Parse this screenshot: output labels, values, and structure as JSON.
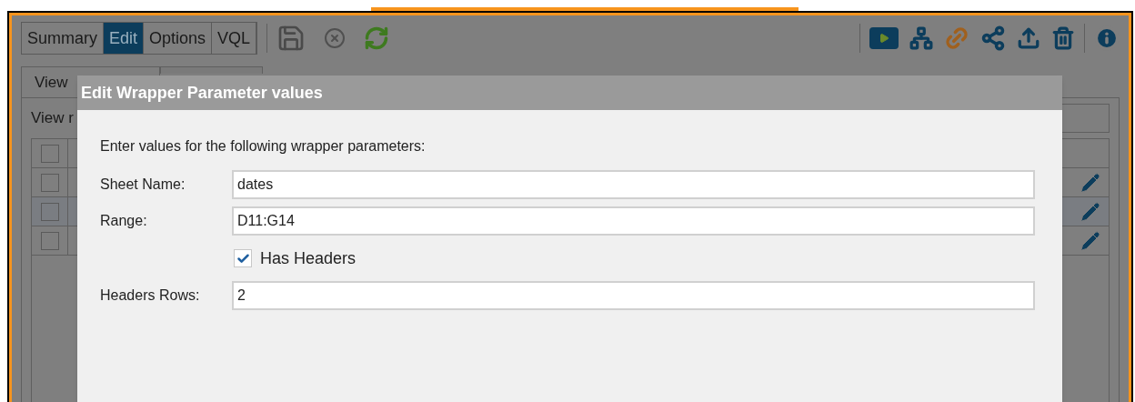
{
  "tabs": [
    {
      "label": "Summary",
      "selected": false
    },
    {
      "label": "Edit",
      "selected": true
    },
    {
      "label": "Options",
      "selected": false
    },
    {
      "label": "VQL",
      "selected": false
    }
  ],
  "sub_tabs": [
    {
      "label": "View",
      "selected": true
    }
  ],
  "panel_label": "View r",
  "table_rows": [
    {
      "checked": false,
      "header": true
    },
    {
      "checked": false,
      "header": false
    },
    {
      "checked": false,
      "header": false
    },
    {
      "checked": false,
      "header": false
    }
  ],
  "dialog": {
    "title": "Edit Wrapper Parameter values",
    "instruction": "Enter values for the following wrapper parameters:",
    "fields": [
      {
        "kind": "text",
        "label": "Sheet Name:",
        "value": "dates"
      },
      {
        "kind": "text",
        "label": "Range:",
        "value": "D11:G14"
      },
      {
        "kind": "checkbox",
        "label": "Has Headers",
        "checked": true
      },
      {
        "kind": "text",
        "label": "Headers Rows:",
        "value": "2"
      }
    ]
  }
}
